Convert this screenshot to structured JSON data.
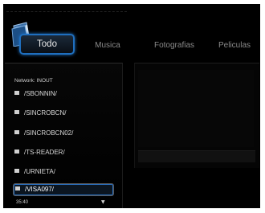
{
  "tabs": [
    {
      "label": "Todo",
      "active": true
    },
    {
      "label": "Musica",
      "active": false
    },
    {
      "label": "Fotografias",
      "active": false
    },
    {
      "label": "Peliculas",
      "active": false
    }
  ],
  "browser": {
    "path": "Network: INOUT",
    "items": [
      {
        "label": "/SBONNIN/",
        "selected": false
      },
      {
        "label": "/SINCROBCN/",
        "selected": false
      },
      {
        "label": "/SINCROBCN02/",
        "selected": false
      },
      {
        "label": "/TS-READER/",
        "selected": false
      },
      {
        "label": "/URNIETA/",
        "selected": false
      },
      {
        "label": "/VISA097/",
        "selected": true
      }
    ],
    "scroll_down": "▼"
  },
  "status": {
    "clock": "35:40"
  },
  "colors": {
    "accent": "#1f6fbf",
    "background": "#000000"
  }
}
